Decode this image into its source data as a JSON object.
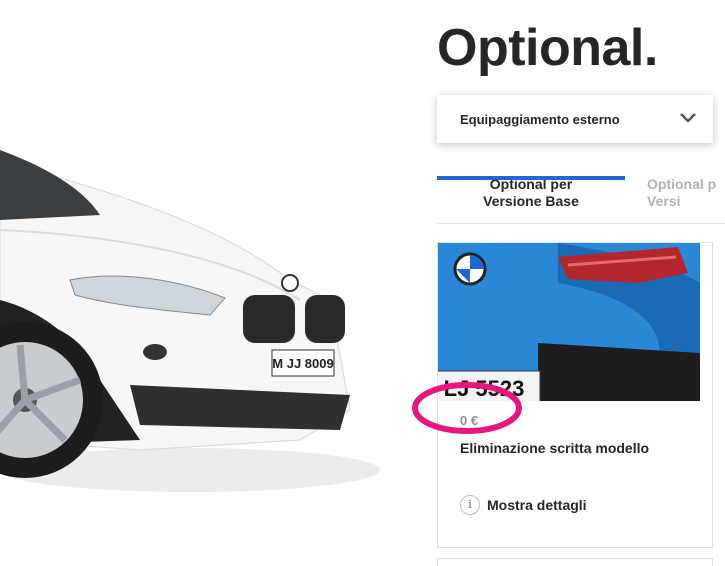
{
  "page": {
    "title": "Optional."
  },
  "category_select": {
    "selected": "Equipaggiamento esterno",
    "icon": "chevron-down-icon"
  },
  "tabs": [
    {
      "label": "Optional per\nVersione Base",
      "active": true
    },
    {
      "label": "Optional p\nVersi",
      "active": false
    }
  ],
  "option_card": {
    "price": "0 €",
    "title": "Eliminazione scritta modello",
    "details_label": "Mostra dettagli",
    "details_icon": "info-icon",
    "info_glyph": "i",
    "image_plate_text": "LJ 5523"
  },
  "car": {
    "plate_text": "M JJ 8009"
  },
  "colors": {
    "accent": "#1c69d4",
    "highlight": "#e6167d",
    "car_body": "#ffffff",
    "card_car": "#1f78c8"
  }
}
